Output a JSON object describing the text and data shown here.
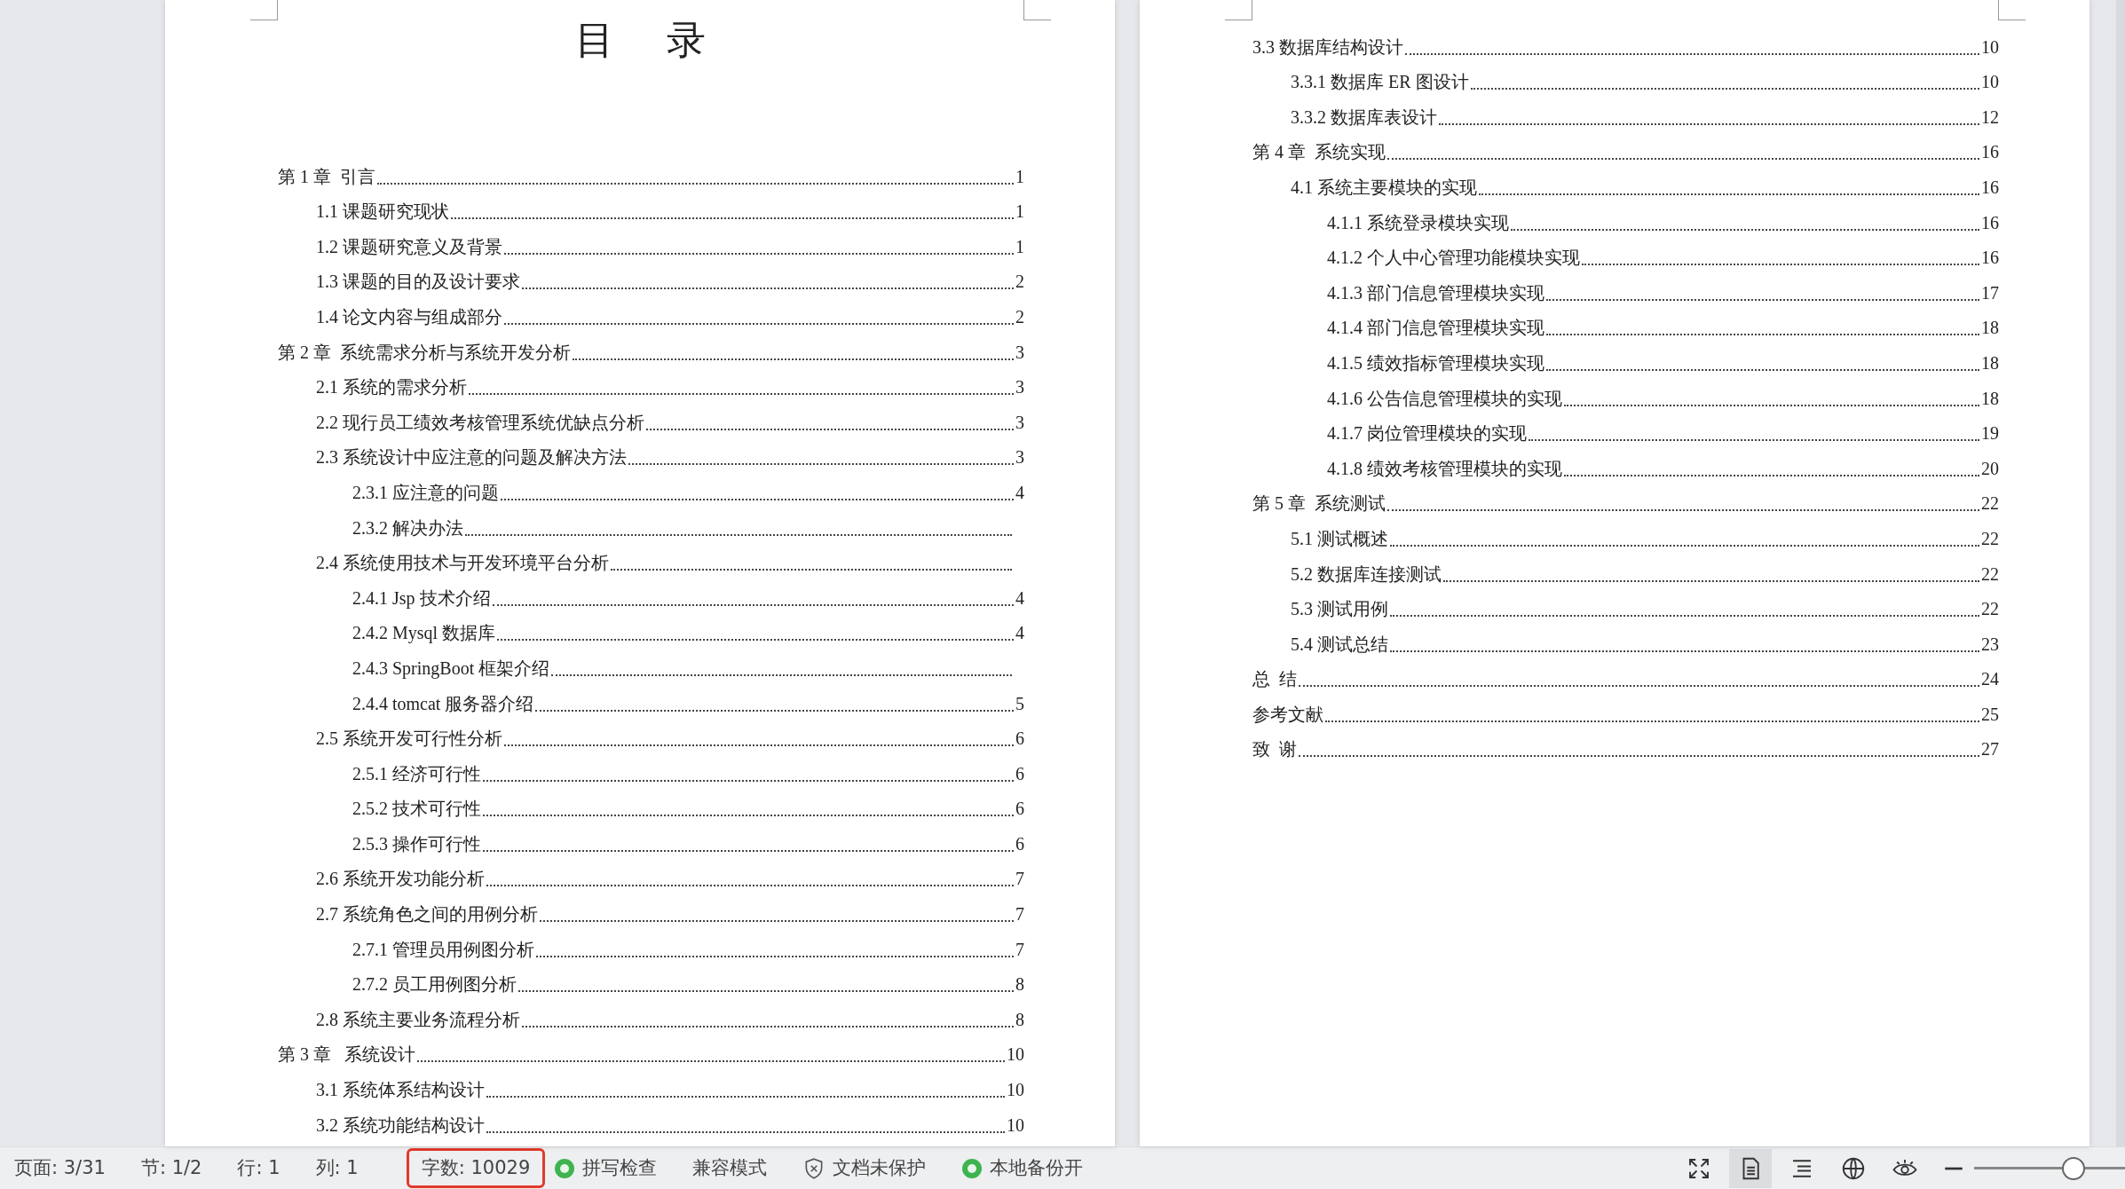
{
  "pages": [
    {
      "title": "目 录",
      "entries": [
        {
          "text": "第 1 章  引言",
          "page": "1",
          "children": [
            {
              "text": "1.1 课题研究现状",
              "page": "1"
            },
            {
              "text": "1.2 课题研究意义及背景",
              "page": "1"
            },
            {
              "text": "1.3 课题的目的及设计要求",
              "page": "2"
            },
            {
              "text": "1.4 论文内容与组成部分",
              "page": "2"
            }
          ]
        },
        {
          "text": "第 2 章  系统需求分析与系统开发分析",
          "page": "3",
          "children": [
            {
              "text": "2.1 系统的需求分析",
              "page": "3"
            },
            {
              "text": "2.2 现行员工绩效考核管理系统优缺点分析",
              "page": "3"
            },
            {
              "text": "2.3 系统设计中应注意的问题及解决方法",
              "page": "3",
              "children": [
                {
                  "text": "2.3.1 应注意的问题",
                  "page": "4"
                },
                {
                  "text": "2.3.2 解决办法"
                }
              ]
            },
            {
              "text": "2.4 系统使用技术与开发环境平台分析",
              "children": [
                {
                  "text": "2.4.1 Jsp 技术介绍",
                  "page": "4"
                },
                {
                  "text": "2.4.2 Mysql 数据库",
                  "page": "4"
                },
                {
                  "text": "2.4.3 SpringBoot 框架介绍"
                },
                {
                  "text": "2.4.4 tomcat 服务器介绍",
                  "page": "5"
                }
              ]
            },
            {
              "text": "2.5 系统开发可行性分析",
              "page": "6",
              "children": [
                {
                  "text": "2.5.1 经济可行性",
                  "page": "6"
                },
                {
                  "text": "2.5.2 技术可行性",
                  "page": "6"
                },
                {
                  "text": "2.5.3 操作可行性",
                  "page": "6"
                }
              ]
            },
            {
              "text": "2.6 系统开发功能分析",
              "page": "7"
            },
            {
              "text": "2.7 系统角色之间的用例分析",
              "page": "7",
              "children": [
                {
                  "text": "2.7.1 管理员用例图分析",
                  "page": "7"
                },
                {
                  "text": "2.7.2 员工用例图分析",
                  "page": "8"
                }
              ]
            },
            {
              "text": "2.8 系统主要业务流程分析",
              "page": "8"
            }
          ]
        },
        {
          "text": "第 3 章   系统设计",
          "page": "10",
          "children": [
            {
              "text": "3.1 系统体系结构设计",
              "page": "10"
            },
            {
              "text": "3.2 系统功能结构设计",
              "page": "10"
            }
          ]
        }
      ]
    },
    {
      "entries": [
        {
          "children": [
            {
              "text": "3.3 数据库结构设计",
              "page": "10",
              "children": [
                {
                  "text": "3.3.1 数据库 ER 图设计",
                  "page": "10"
                },
                {
                  "text": "3.3.2 数据库表设计",
                  "page": "12"
                }
              ]
            }
          ]
        },
        {
          "text": "第 4 章  系统实现",
          "page": "16",
          "children": [
            {
              "text": "4.1 系统主要模块的实现",
              "page": "16",
              "children": [
                {
                  "text": "4.1.1 系统登录模块实现",
                  "page": "16"
                },
                {
                  "text": "4.1.2 个人中心管理功能模块实现",
                  "page": "16"
                },
                {
                  "text": "4.1.3 部门信息管理模块实现",
                  "page": "17"
                },
                {
                  "text": "4.1.4 部门信息管理模块实现",
                  "page": "18"
                },
                {
                  "text": "4.1.5 绩效指标管理模块实现",
                  "page": "18"
                },
                {
                  "text": "4.1.6 公告信息管理模块的实现",
                  "page": "18"
                },
                {
                  "text": "4.1.7 岗位管理模块的实现",
                  "page": "19"
                },
                {
                  "text": "4.1.8 绩效考核管理模块的实现",
                  "page": "20"
                }
              ]
            }
          ]
        },
        {
          "text": "第 5 章  系统测试",
          "page": "22",
          "children": [
            {
              "text": "5.1 测试概述",
              "page": "22"
            },
            {
              "text": "5.2 数据库连接测试",
              "page": "22"
            },
            {
              "text": "5.3 测试用例",
              "page": "22"
            },
            {
              "text": "5.4 测试总结",
              "page": "23"
            }
          ]
        },
        {
          "text": "总  结",
          "page": "24"
        },
        {
          "text": "参考文献",
          "page": "25"
        },
        {
          "text": "致  谢",
          "page": "27"
        }
      ]
    }
  ],
  "status_bar": {
    "items": [
      {
        "kind": "text",
        "label": "页面: 3/31"
      },
      {
        "kind": "text",
        "label": "节: 1/2"
      },
      {
        "kind": "text",
        "label": "行: 1"
      },
      {
        "kind": "text",
        "label": "列: 1"
      },
      {
        "kind": "text",
        "label": "字数: 10029",
        "highlighted": true
      },
      {
        "kind": "status",
        "label": "拼写检查"
      },
      {
        "kind": "text",
        "label": "兼容模式"
      },
      {
        "kind": "shield",
        "label": "文档未保护"
      },
      {
        "kind": "status",
        "label": "本地备份开"
      }
    ],
    "views": [
      {
        "kind": "fullscreen",
        "selected": false
      },
      {
        "kind": "page",
        "selected": true
      },
      {
        "kind": "outline",
        "selected": false
      },
      {
        "kind": "web",
        "selected": false
      },
      {
        "kind": "eye",
        "selected": false
      }
    ],
    "zoom": {
      "level": 0.66
    }
  }
}
